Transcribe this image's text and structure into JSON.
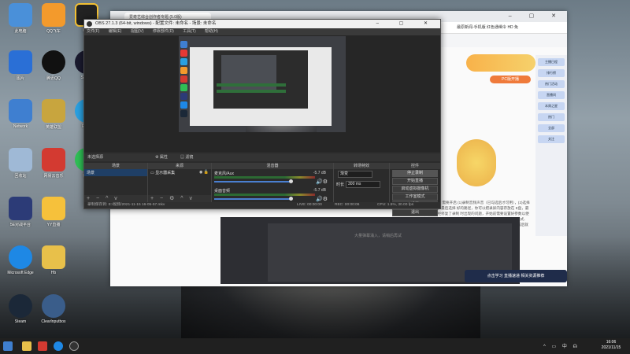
{
  "desktop": {
    "icons": [
      {
        "label": "此电脑",
        "color": "#4a90d9"
      },
      {
        "label": "QQ飞车",
        "color": "#f39a2c"
      },
      {
        "label": "OBS",
        "color": "#222222"
      },
      {
        "label": "图片",
        "color": "#2a6fd6"
      },
      {
        "label": "腾讯QQ",
        "color": "#e53935"
      },
      {
        "label": "Steam",
        "color": "#1a1a2e"
      },
      {
        "label": "Network",
        "color": "#3f7fd0"
      },
      {
        "label": "英雄联盟",
        "color": "#c8a53e"
      },
      {
        "label": "Edge",
        "color": "#2aa0e0"
      },
      {
        "label": "回收站",
        "color": "#9fb9d6"
      },
      {
        "label": "网易云音乐",
        "color": "#d33a31"
      },
      {
        "label": "微信",
        "color": "#2fbf55"
      },
      {
        "label": "5E对战平台",
        "color": "#2c3b77"
      },
      {
        "label": "YY直播",
        "color": "#f6c13b"
      },
      {
        "label": "Microsoft Edge",
        "color": "#1e88e5"
      },
      {
        "label": "Hb",
        "color": "#e8c04a"
      },
      {
        "label": "Steam",
        "color": "#1b2838"
      },
      {
        "label": "ClearInputbox",
        "color": "#3a5d8a"
      }
    ]
  },
  "browser": {
    "tab_title": "爱奇艺综合创作者专题  (5.0版)",
    "favorites": "最原新闻-手机版  红色通缉令 HD 免",
    "live_button": "PC版开播",
    "sidebar_items": [
      "主播日程",
      "排行榜",
      "热门活动",
      "直播间",
      "本周之星",
      "热门",
      "全部",
      "关注"
    ],
    "article_text": "注意：需要开启 (1)录制音频声音（已勾选后才可用），(2)选择录音位置即可，最后选择 好的路径，你可以把录屏内容存放在 E盘，最新的版本中已经修复了录制 时出现的问题，开始前需要设置好参数以便得到 好的效果，录制完成后点击 停止录制，在设置中选择 输出模式、录制路径、 录像格式 ，视频 编码器，音频比特率，全部 设置完成后就可以录制 了，祝大家学习愉快。",
    "highlight_word": "开启录制",
    "comment_hint": "大量弹幕涌入，请稍后再试",
    "study_banner": "点击学习  直播速递  相关资源推荐"
  },
  "obs": {
    "title": "OBS 27.1.3 (64-bit, windows) - 配置文件: 未命名 - 场景: 未命名",
    "menu": [
      "文件(F)",
      "编辑(E)",
      "视图(V)",
      "停靠部件(D)",
      "工具(T)",
      "帮助(H)"
    ],
    "source_bar": {
      "label": "未选择源",
      "properties": "属性",
      "filters": "滤镜"
    },
    "docks": {
      "scenes": {
        "title": "场景",
        "items": [
          "场景"
        ]
      },
      "sources": {
        "title": "来源",
        "items": [
          "显示器采集"
        ]
      },
      "mixer": {
        "title": "混音器",
        "channels": [
          {
            "name": "麦克风/Aux",
            "db": "-5.7 dB",
            "level": 0.8
          },
          {
            "name": "桌面音频",
            "db": "-5.7 dB",
            "level": 0.8
          }
        ]
      },
      "transitions": {
        "title": "转场特效",
        "type": "渐变",
        "duration_label": "时长",
        "duration": "300 ms"
      },
      "controls": {
        "title": "控件",
        "buttons": [
          "停止录制",
          "开始直播",
          "启动虚拟摄像机",
          "工作室模式",
          "设置",
          "退出"
        ]
      }
    },
    "status": {
      "left": "录制保存到: E:/视频/2021-11-15 16-05-57.mkv",
      "live": "LIVE: 00:00:00",
      "rec": "REC: 00:00:06",
      "cpu": "CPU: 1.5%, 30.00 fps"
    }
  },
  "taskbar": {
    "tray": "^ ▭ 中 ☊",
    "time": "16:06",
    "date": "2021/11/15"
  }
}
